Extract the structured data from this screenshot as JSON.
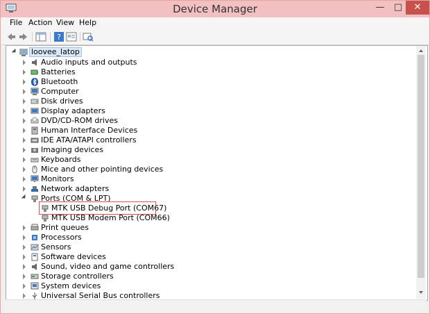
{
  "window": {
    "title": "Device Manager"
  },
  "menubar": {
    "items": [
      "File",
      "Action",
      "View",
      "Help"
    ]
  },
  "tree": {
    "root": "loovee_latop",
    "categories": [
      {
        "label": "Audio inputs and outputs",
        "icon": "speaker-icon"
      },
      {
        "label": "Batteries",
        "icon": "battery-icon"
      },
      {
        "label": "Bluetooth",
        "icon": "bluetooth-icon"
      },
      {
        "label": "Computer",
        "icon": "computer-icon"
      },
      {
        "label": "Disk drives",
        "icon": "disk-icon"
      },
      {
        "label": "Display adapters",
        "icon": "display-icon"
      },
      {
        "label": "DVD/CD-ROM drives",
        "icon": "dvd-icon"
      },
      {
        "label": "Human Interface Devices",
        "icon": "hid-icon"
      },
      {
        "label": "IDE ATA/ATAPI controllers",
        "icon": "ide-icon"
      },
      {
        "label": "Imaging devices",
        "icon": "camera-icon"
      },
      {
        "label": "Keyboards",
        "icon": "keyboard-icon"
      },
      {
        "label": "Mice and other pointing devices",
        "icon": "mouse-icon"
      },
      {
        "label": "Monitors",
        "icon": "monitor-icon"
      },
      {
        "label": "Network adapters",
        "icon": "network-icon"
      },
      {
        "label": "Ports (COM & LPT)",
        "icon": "port-icon",
        "expanded": true,
        "children": [
          {
            "label": "MTK USB Debug Port (COM67)",
            "icon": "port-icon"
          },
          {
            "label": "MTK USB Modem Port (COM66)",
            "icon": "port-icon"
          }
        ]
      },
      {
        "label": "Print queues",
        "icon": "printer-icon"
      },
      {
        "label": "Processors",
        "icon": "processor-icon"
      },
      {
        "label": "Sensors",
        "icon": "sensor-icon"
      },
      {
        "label": "Software devices",
        "icon": "software-icon"
      },
      {
        "label": "Sound, video and game controllers",
        "icon": "speaker-icon"
      },
      {
        "label": "Storage controllers",
        "icon": "storage-icon"
      },
      {
        "label": "System devices",
        "icon": "system-icon"
      },
      {
        "label": "Universal Serial Bus controllers",
        "icon": "usb-icon"
      }
    ]
  }
}
